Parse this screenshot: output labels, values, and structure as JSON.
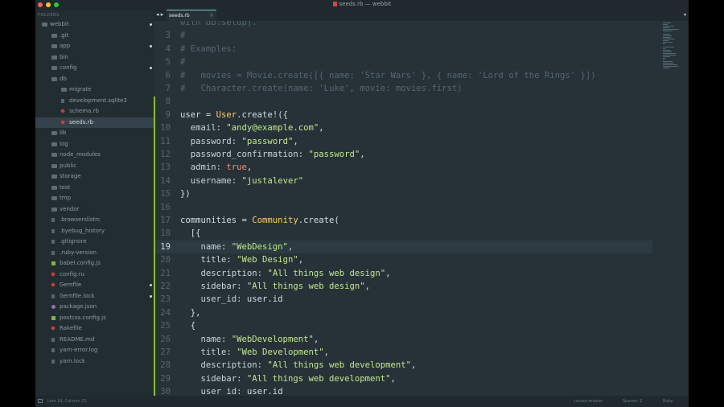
{
  "window": {
    "title": "seeds.rb — webbit"
  },
  "sidebar": {
    "header": "FOLDERS",
    "items": [
      {
        "label": "webbit",
        "type": "folder",
        "depth": 0,
        "dot": true
      },
      {
        "label": ".git",
        "type": "folder",
        "depth": 1,
        "dot": false
      },
      {
        "label": "app",
        "type": "folder",
        "depth": 1,
        "dot": true
      },
      {
        "label": "bin",
        "type": "folder",
        "depth": 1,
        "dot": false
      },
      {
        "label": "config",
        "type": "folder",
        "depth": 1,
        "dot": true
      },
      {
        "label": "db",
        "type": "folder",
        "depth": 1,
        "dot": false
      },
      {
        "label": "migrate",
        "type": "folder",
        "depth": 2,
        "dot": false
      },
      {
        "label": "development.sqlite3",
        "type": "file",
        "depth": 2,
        "dot": false
      },
      {
        "label": "schema.rb",
        "type": "ruby",
        "depth": 2,
        "dot": false
      },
      {
        "label": "seeds.rb",
        "type": "ruby",
        "depth": 2,
        "dot": false,
        "selected": true
      },
      {
        "label": "lib",
        "type": "folder",
        "depth": 1,
        "dot": false
      },
      {
        "label": "log",
        "type": "folder",
        "depth": 1,
        "dot": false
      },
      {
        "label": "node_modules",
        "type": "folder",
        "depth": 1,
        "dot": false
      },
      {
        "label": "public",
        "type": "folder",
        "depth": 1,
        "dot": false
      },
      {
        "label": "storage",
        "type": "folder",
        "depth": 1,
        "dot": false
      },
      {
        "label": "test",
        "type": "folder",
        "depth": 1,
        "dot": false
      },
      {
        "label": "tmp",
        "type": "folder",
        "depth": 1,
        "dot": false
      },
      {
        "label": "vendor",
        "type": "folder",
        "depth": 1,
        "dot": false
      },
      {
        "label": ".browserslistrc",
        "type": "file",
        "depth": 1,
        "dot": false
      },
      {
        "label": ".byebug_history",
        "type": "file",
        "depth": 1,
        "dot": false
      },
      {
        "label": ".gitignore",
        "type": "file",
        "depth": 1,
        "dot": false
      },
      {
        "label": ".ruby-version",
        "type": "file",
        "depth": 1,
        "dot": false
      },
      {
        "label": "babel.config.js",
        "type": "js",
        "depth": 1,
        "dot": false
      },
      {
        "label": "config.ru",
        "type": "ruby",
        "depth": 1,
        "dot": false
      },
      {
        "label": "Gemfile",
        "type": "ruby",
        "depth": 1,
        "dot": true
      },
      {
        "label": "Gemfile.lock",
        "type": "file",
        "depth": 1,
        "dot": true
      },
      {
        "label": "package.json",
        "type": "gear",
        "depth": 1,
        "dot": false
      },
      {
        "label": "postcss.config.js",
        "type": "js",
        "depth": 1,
        "dot": false
      },
      {
        "label": "Rakefile",
        "type": "ruby",
        "depth": 1,
        "dot": false
      },
      {
        "label": "README.md",
        "type": "file",
        "depth": 1,
        "dot": false
      },
      {
        "label": "yarn-error.log",
        "type": "file",
        "depth": 1,
        "dot": false
      },
      {
        "label": "yarn.lock",
        "type": "file",
        "depth": 1,
        "dot": false
      }
    ]
  },
  "tabs": {
    "nav": "◂ ▸",
    "active": "seeds.rb",
    "close": "×",
    "menu": "▾"
  },
  "code": {
    "active_line": 19,
    "lines": [
      {
        "n": "",
        "tokens": [
          [
            "c-cmt",
            "with db:setup)."
          ]
        ]
      },
      {
        "n": "3",
        "tokens": [
          [
            "c-cmt",
            "#"
          ]
        ]
      },
      {
        "n": "4",
        "tokens": [
          [
            "c-cmt",
            "# Examples:"
          ]
        ]
      },
      {
        "n": "5",
        "tokens": [
          [
            "c-cmt",
            "#"
          ]
        ]
      },
      {
        "n": "6",
        "tokens": [
          [
            "c-cmt",
            "#   movies = Movie.create([{ name: 'Star Wars' }, { name: 'Lord of the Rings' }])"
          ]
        ]
      },
      {
        "n": "7",
        "tokens": [
          [
            "c-cmt",
            "#   Character.create(name: 'Luke', movie: movies.first)"
          ]
        ]
      },
      {
        "n": "8",
        "tokens": []
      },
      {
        "n": "9",
        "tokens": [
          [
            "c-sym",
            "user = "
          ],
          [
            "c-cls",
            "User"
          ],
          [
            "c-sym",
            ".create!({"
          ]
        ]
      },
      {
        "n": "10",
        "tokens": [
          [
            "c-key",
            "  email: "
          ],
          [
            "c-str",
            "\"andy@example.com\""
          ],
          [
            "c-sym",
            ","
          ]
        ]
      },
      {
        "n": "11",
        "tokens": [
          [
            "c-key",
            "  password: "
          ],
          [
            "c-str",
            "\"password\""
          ],
          [
            "c-sym",
            ","
          ]
        ]
      },
      {
        "n": "12",
        "tokens": [
          [
            "c-key",
            "  password_confirmation: "
          ],
          [
            "c-str",
            "\"password\""
          ],
          [
            "c-sym",
            ","
          ]
        ]
      },
      {
        "n": "13",
        "tokens": [
          [
            "c-key",
            "  admin: "
          ],
          [
            "c-bool",
            "true"
          ],
          [
            "c-sym",
            ","
          ]
        ]
      },
      {
        "n": "14",
        "tokens": [
          [
            "c-key",
            "  username: "
          ],
          [
            "c-str",
            "\"justalever\""
          ]
        ]
      },
      {
        "n": "15",
        "tokens": [
          [
            "c-sym",
            "})"
          ]
        ]
      },
      {
        "n": "16",
        "tokens": []
      },
      {
        "n": "17",
        "tokens": [
          [
            "c-sym",
            "communities = "
          ],
          [
            "c-cls",
            "Community"
          ],
          [
            "c-sym",
            ".create("
          ]
        ]
      },
      {
        "n": "18",
        "tokens": [
          [
            "c-sym",
            "  [{"
          ]
        ]
      },
      {
        "n": "19",
        "tokens": [
          [
            "c-key",
            "    name: "
          ],
          [
            "c-str",
            "\"WebDesign\""
          ],
          [
            "c-sym",
            ","
          ]
        ]
      },
      {
        "n": "20",
        "tokens": [
          [
            "c-key",
            "    title: "
          ],
          [
            "c-str",
            "\"Web Design\""
          ],
          [
            "c-sym",
            ","
          ]
        ]
      },
      {
        "n": "21",
        "tokens": [
          [
            "c-key",
            "    description: "
          ],
          [
            "c-str",
            "\"All things web design\""
          ],
          [
            "c-sym",
            ","
          ]
        ]
      },
      {
        "n": "22",
        "tokens": [
          [
            "c-key",
            "    sidebar: "
          ],
          [
            "c-str",
            "\"All things web design\""
          ],
          [
            "c-sym",
            ","
          ]
        ]
      },
      {
        "n": "23",
        "tokens": [
          [
            "c-key",
            "    user_id: "
          ],
          [
            "c-sym",
            "user.id"
          ]
        ]
      },
      {
        "n": "24",
        "tokens": [
          [
            "c-sym",
            "  },"
          ]
        ]
      },
      {
        "n": "25",
        "tokens": [
          [
            "c-sym",
            "  {"
          ]
        ]
      },
      {
        "n": "26",
        "tokens": [
          [
            "c-key",
            "    name: "
          ],
          [
            "c-str",
            "\"WebDevelopment\""
          ],
          [
            "c-sym",
            ","
          ]
        ]
      },
      {
        "n": "27",
        "tokens": [
          [
            "c-key",
            "    title: "
          ],
          [
            "c-str",
            "\"Web Development\""
          ],
          [
            "c-sym",
            ","
          ]
        ]
      },
      {
        "n": "28",
        "tokens": [
          [
            "c-key",
            "    description: "
          ],
          [
            "c-str",
            "\"All things web development\""
          ],
          [
            "c-sym",
            ","
          ]
        ]
      },
      {
        "n": "29",
        "tokens": [
          [
            "c-key",
            "    sidebar: "
          ],
          [
            "c-str",
            "\"All things web development\""
          ],
          [
            "c-sym",
            ","
          ]
        ]
      },
      {
        "n": "30",
        "tokens": [
          [
            "c-key",
            "    user_id: "
          ],
          [
            "c-sym",
            "user.id"
          ]
        ]
      }
    ]
  },
  "statusbar": {
    "position": "Line 19, Column 23",
    "branch": "course-master",
    "spaces": "Spaces: 2",
    "language": "Ruby"
  }
}
